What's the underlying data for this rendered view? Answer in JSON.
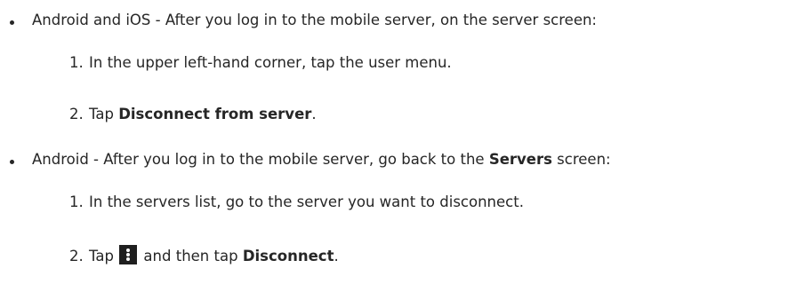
{
  "items": [
    {
      "text": "Android and iOS - After you log in to the mobile server, on the server screen:",
      "steps": [
        {
          "number": "1.",
          "text": "In the upper left-hand corner, tap the user menu."
        },
        {
          "number": "2.",
          "prefix": "Tap ",
          "bold": "Disconnect from server",
          "suffix": "."
        }
      ]
    },
    {
      "prefix": "Android - After you log in to the mobile server, go back to the ",
      "bold": "Servers",
      "suffix": " screen:",
      "steps": [
        {
          "number": "1.",
          "text": "In the servers list, go to the server you want to disconnect."
        },
        {
          "number": "2.",
          "prefix": "Tap ",
          "icon": "more-vertical-icon",
          "middle": " and then tap ",
          "bold": "Disconnect",
          "suffix": "."
        }
      ]
    }
  ]
}
